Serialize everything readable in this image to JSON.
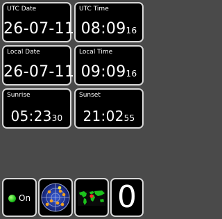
{
  "tiles": {
    "utc_date": {
      "label": "UTC Date",
      "value": "26-07-11"
    },
    "utc_time": {
      "label": "UTC Time",
      "main": "08:09",
      "sec": "16"
    },
    "local_date": {
      "label": "Local Date",
      "value": "26-07-11"
    },
    "local_time": {
      "label": "Local Time",
      "main": "09:09",
      "sec": "16"
    },
    "sunrise": {
      "label": "Sunrise",
      "main": "05:23",
      "sec": "30"
    },
    "sunset": {
      "label": "Sunset",
      "main": "21:02",
      "sec": "55"
    }
  },
  "bottom": {
    "status_label": "On",
    "status_color": "#22c21e",
    "radar_icon": "satellite-radar-icon",
    "map_icon": "world-map-icon",
    "counter": "0"
  }
}
